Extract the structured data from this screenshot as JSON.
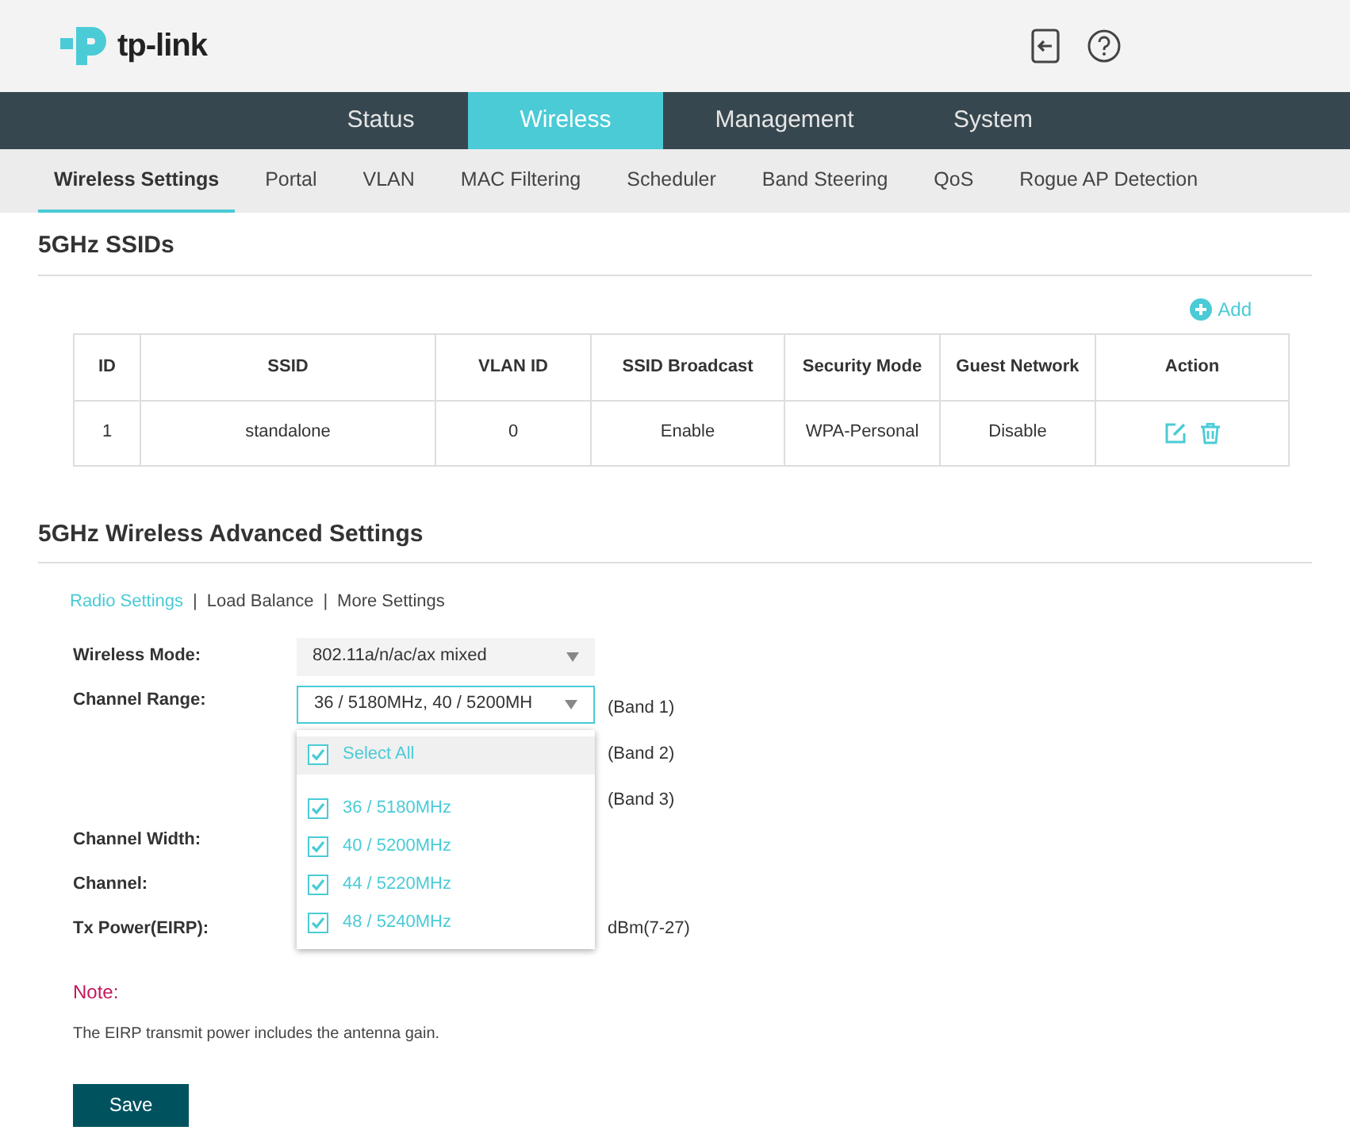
{
  "header": {
    "logo": "tp-link"
  },
  "main_tabs": [
    {
      "label": "Status",
      "selected": false
    },
    {
      "label": "Wireless",
      "selected": true
    },
    {
      "label": "Management",
      "selected": false
    },
    {
      "label": "System",
      "selected": false
    }
  ],
  "sub_tabs": [
    {
      "label": "Wireless Settings",
      "selected": true
    },
    {
      "label": "Portal",
      "selected": false
    },
    {
      "label": "VLAN",
      "selected": false
    },
    {
      "label": "MAC Filtering",
      "selected": false
    },
    {
      "label": "Scheduler",
      "selected": false
    },
    {
      "label": "Band Steering",
      "selected": false
    },
    {
      "label": "QoS",
      "selected": false
    },
    {
      "label": "Rogue AP Detection",
      "selected": false
    }
  ],
  "ssids": {
    "title": "5GHz SSIDs",
    "add_label": "Add",
    "columns": [
      "ID",
      "SSID",
      "VLAN ID",
      "SSID Broadcast",
      "Security Mode",
      "Guest Network",
      "Action"
    ],
    "rows": [
      {
        "cells": [
          "1",
          "standalone",
          "0",
          "Enable",
          "WPA-Personal",
          "Disable"
        ]
      }
    ]
  },
  "advanced": {
    "title": "5GHz Wireless Advanced Settings",
    "link_separator": "|",
    "section_links": [
      {
        "label": "Radio Settings",
        "selected": true
      },
      {
        "label": "Load Balance",
        "selected": false
      },
      {
        "label": "More Settings",
        "selected": false
      }
    ],
    "wireless_mode": {
      "label": "Wireless Mode:",
      "value": "802.11a/n/ac/ax mixed"
    },
    "channel_range": {
      "label": "Channel Range:",
      "value": "36 / 5180MHz, 40 / 5200MH",
      "expanded": true,
      "bands": [
        "(Band 1)",
        "(Band 2)",
        "(Band 3)"
      ],
      "options": [
        {
          "kind": "select_all",
          "label": "Select All",
          "checked": true,
          "selected": true
        },
        {
          "kind": "option",
          "label": "36 / 5180MHz",
          "checked": true,
          "selected": false
        },
        {
          "kind": "option",
          "label": "40 / 5200MHz",
          "checked": true,
          "selected": false
        },
        {
          "kind": "option",
          "label": "44 / 5220MHz",
          "checked": true,
          "selected": false
        },
        {
          "kind": "option",
          "label": "48 / 5240MHz",
          "checked": true,
          "selected": false
        }
      ]
    },
    "channel_width": {
      "label": "Channel Width:"
    },
    "channel": {
      "label": "Channel:"
    },
    "tx_power": {
      "label": "Tx Power(EIRP):",
      "unit": "dBm(7-27)"
    },
    "note_title": "Note:",
    "note_text": "The EIRP transmit power includes the antenna gain.",
    "save_label": "Save"
  }
}
